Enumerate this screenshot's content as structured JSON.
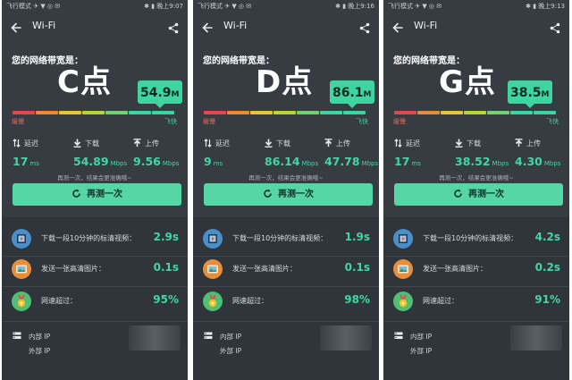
{
  "common": {
    "status_left": "飞行模式 ✈ ▼ ◎ ✉",
    "toolbar_title": "Wi-Fi",
    "bandwidth_title": "您的网络带宽是：",
    "scale_low": "缓慢",
    "scale_high": "飞快",
    "latency_label": "延迟",
    "download_label": "下载",
    "upload_label": "上传",
    "latency_unit": "ms",
    "rate_unit": "Mbps",
    "retest_hint": "再测一次，结果会更准确哦~",
    "retest_button": "再测一次",
    "video_label": "下载一段10分钟的标清视频：",
    "image_label": "发送一张高清图片：",
    "beat_label": "网速超过：",
    "internal_ip_label": "内部 IP",
    "external_ip_label": "外部 IP",
    "scale_colors": [
      "#e04a4a",
      "#ec8a3b",
      "#e8c23d",
      "#b8d43c",
      "#6fd66f",
      "#3fd5a0",
      "#3fd5a0"
    ],
    "accent_color": "#42d7a2"
  },
  "panels": [
    {
      "status_time": "✱ ▮ 晚上9:07",
      "grade": "C点",
      "speed_value": "54.9",
      "speed_unit": "M",
      "latency": "17",
      "download": "54.89",
      "upload": "9.56",
      "video_time": "2.9s",
      "image_time": "0.1s",
      "beat_percent": "95%"
    },
    {
      "status_time": "✱ ▮ 晚上9:16",
      "grade": "D点",
      "speed_value": "86.1",
      "speed_unit": "M",
      "latency": "9",
      "download": "86.14",
      "upload": "47.78",
      "video_time": "1.9s",
      "image_time": "0.1s",
      "beat_percent": "98%"
    },
    {
      "status_time": "✱ ▮ 晚上9:13",
      "grade": "G点",
      "speed_value": "38.5",
      "speed_unit": "M",
      "latency": "17",
      "download": "38.52",
      "upload": "4.30",
      "video_time": "4.2s",
      "image_time": "0.2s",
      "beat_percent": "91%"
    }
  ]
}
